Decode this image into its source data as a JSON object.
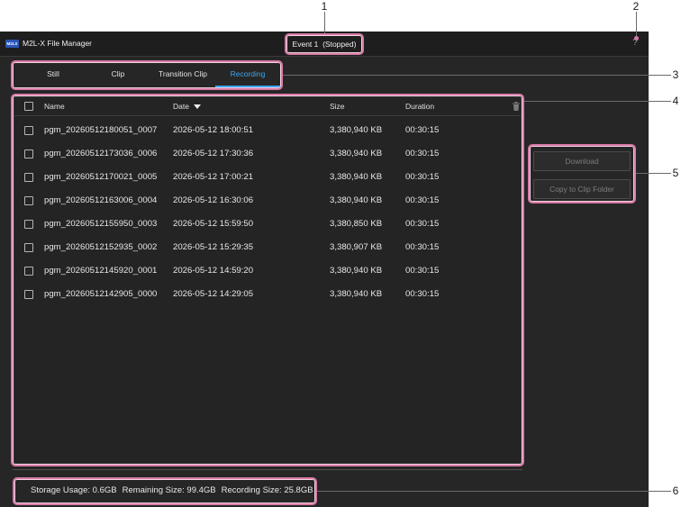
{
  "app": {
    "logo_text": "M2LX",
    "title": "M2L-X File Manager",
    "event_status": "Event 1  (Stopped)",
    "help_label": "?"
  },
  "tabs": [
    {
      "label": "Still",
      "active": false
    },
    {
      "label": "Clip",
      "active": false
    },
    {
      "label": "Transition Clip",
      "active": false
    },
    {
      "label": "Recording",
      "active": true
    }
  ],
  "table": {
    "columns": {
      "name": "Name",
      "date": "Date",
      "size": "Size",
      "duration": "Duration"
    },
    "sort_icon": "caret-down-icon",
    "delete_icon": "trash-icon",
    "select_all_checked": false,
    "rows": [
      {
        "name": "pgm_20260512180051_0007",
        "date": "2026-05-12 18:00:51",
        "size": "3,380,940 KB",
        "duration": "00:30:15",
        "checked": false
      },
      {
        "name": "pgm_20260512173036_0006",
        "date": "2026-05-12 17:30:36",
        "size": "3,380,940 KB",
        "duration": "00:30:15",
        "checked": false
      },
      {
        "name": "pgm_20260512170021_0005",
        "date": "2026-05-12 17:00:21",
        "size": "3,380,940 KB",
        "duration": "00:30:15",
        "checked": false
      },
      {
        "name": "pgm_20260512163006_0004",
        "date": "2026-05-12 16:30:06",
        "size": "3,380,940 KB",
        "duration": "00:30:15",
        "checked": false
      },
      {
        "name": "pgm_20260512155950_0003",
        "date": "2026-05-12 15:59:50",
        "size": "3,380,850 KB",
        "duration": "00:30:15",
        "checked": false
      },
      {
        "name": "pgm_20260512152935_0002",
        "date": "2026-05-12 15:29:35",
        "size": "3,380,907 KB",
        "duration": "00:30:15",
        "checked": false
      },
      {
        "name": "pgm_20260512145920_0001",
        "date": "2026-05-12 14:59:20",
        "size": "3,380,940 KB",
        "duration": "00:30:15",
        "checked": false
      },
      {
        "name": "pgm_20260512142905_0000",
        "date": "2026-05-12 14:29:05",
        "size": "3,380,940 KB",
        "duration": "00:30:15",
        "checked": false
      }
    ]
  },
  "actions": {
    "download": "Download",
    "copy_to_clip_folder": "Copy to Clip Folder",
    "disabled": true
  },
  "status": {
    "storage_usage": "Storage Usage: 0.6GB",
    "remaining_size": "Remaining Size: 99.4GB",
    "recording_size": "Recording Size: 25.8GB"
  },
  "callouts": [
    "1",
    "2",
    "3",
    "4",
    "5",
    "6"
  ],
  "colors": {
    "accent": "#3ea6ee",
    "highlight": "#d87aa6",
    "window_background": "#262626"
  }
}
